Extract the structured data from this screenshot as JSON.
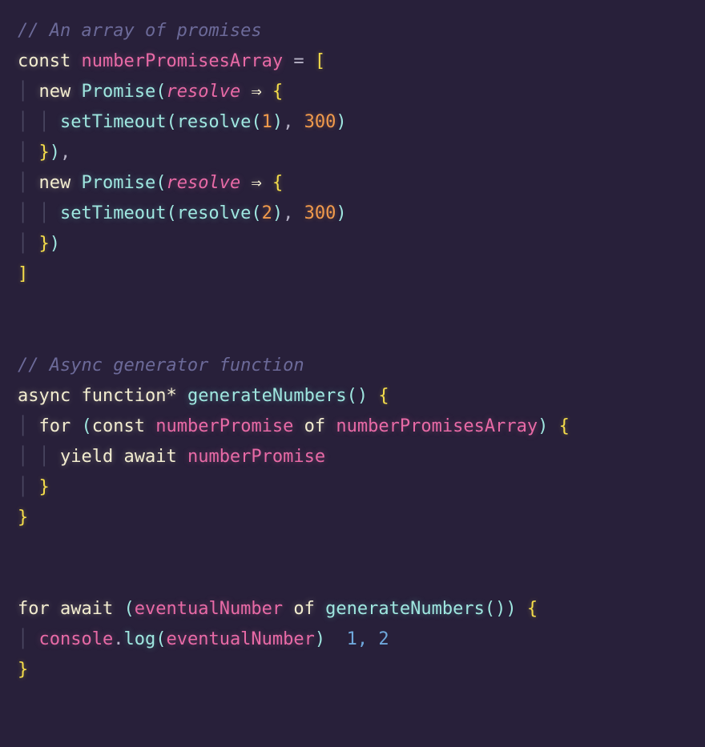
{
  "code": {
    "lines": [
      [
        {
          "cls": "tok-comment",
          "text": "// An array of promises"
        }
      ],
      [
        {
          "cls": "tok-keyword",
          "text": "const"
        },
        {
          "cls": "",
          "text": " "
        },
        {
          "cls": "tok-ident",
          "text": "numberPromisesArray"
        },
        {
          "cls": "",
          "text": " "
        },
        {
          "cls": "tok-op",
          "text": "="
        },
        {
          "cls": "",
          "text": " "
        },
        {
          "cls": "tok-bracket",
          "text": "["
        }
      ],
      [
        {
          "cls": "tok-guide",
          "text": "│ "
        },
        {
          "cls": "tok-keyword",
          "text": "new"
        },
        {
          "cls": "",
          "text": " "
        },
        {
          "cls": "tok-fn",
          "text": "Promise"
        },
        {
          "cls": "tok-paren",
          "text": "("
        },
        {
          "cls": "tok-arg",
          "text": "resolve"
        },
        {
          "cls": "",
          "text": " "
        },
        {
          "cls": "tok-arrow",
          "text": "⇒"
        },
        {
          "cls": "",
          "text": " "
        },
        {
          "cls": "tok-brace",
          "text": "{"
        }
      ],
      [
        {
          "cls": "tok-guide",
          "text": "│ │ "
        },
        {
          "cls": "tok-fn",
          "text": "setTimeout"
        },
        {
          "cls": "tok-paren",
          "text": "("
        },
        {
          "cls": "tok-fn",
          "text": "resolve"
        },
        {
          "cls": "tok-paren",
          "text": "("
        },
        {
          "cls": "tok-num",
          "text": "1"
        },
        {
          "cls": "tok-paren",
          "text": ")"
        },
        {
          "cls": "tok-punct",
          "text": ", "
        },
        {
          "cls": "tok-num",
          "text": "300"
        },
        {
          "cls": "tok-paren",
          "text": ")"
        }
      ],
      [
        {
          "cls": "tok-guide",
          "text": "│ "
        },
        {
          "cls": "tok-brace",
          "text": "}"
        },
        {
          "cls": "tok-paren",
          "text": ")"
        },
        {
          "cls": "tok-punct",
          "text": ","
        }
      ],
      [
        {
          "cls": "tok-guide",
          "text": "│ "
        },
        {
          "cls": "tok-keyword",
          "text": "new"
        },
        {
          "cls": "",
          "text": " "
        },
        {
          "cls": "tok-fn",
          "text": "Promise"
        },
        {
          "cls": "tok-paren",
          "text": "("
        },
        {
          "cls": "tok-arg",
          "text": "resolve"
        },
        {
          "cls": "",
          "text": " "
        },
        {
          "cls": "tok-arrow",
          "text": "⇒"
        },
        {
          "cls": "",
          "text": " "
        },
        {
          "cls": "tok-brace",
          "text": "{"
        }
      ],
      [
        {
          "cls": "tok-guide",
          "text": "│ │ "
        },
        {
          "cls": "tok-fn",
          "text": "setTimeout"
        },
        {
          "cls": "tok-paren",
          "text": "("
        },
        {
          "cls": "tok-fn",
          "text": "resolve"
        },
        {
          "cls": "tok-paren",
          "text": "("
        },
        {
          "cls": "tok-num",
          "text": "2"
        },
        {
          "cls": "tok-paren",
          "text": ")"
        },
        {
          "cls": "tok-punct",
          "text": ", "
        },
        {
          "cls": "tok-num",
          "text": "300"
        },
        {
          "cls": "tok-paren",
          "text": ")"
        }
      ],
      [
        {
          "cls": "tok-guide",
          "text": "│ "
        },
        {
          "cls": "tok-brace",
          "text": "}"
        },
        {
          "cls": "tok-paren",
          "text": ")"
        }
      ],
      [
        {
          "cls": "tok-bracket",
          "text": "]"
        }
      ],
      [],
      [],
      [
        {
          "cls": "tok-comment",
          "text": "// Async generator function"
        }
      ],
      [
        {
          "cls": "tok-keyword",
          "text": "async"
        },
        {
          "cls": "",
          "text": " "
        },
        {
          "cls": "tok-keyword",
          "text": "function*"
        },
        {
          "cls": "",
          "text": " "
        },
        {
          "cls": "tok-fn",
          "text": "generateNumbers"
        },
        {
          "cls": "tok-paren",
          "text": "()"
        },
        {
          "cls": "",
          "text": " "
        },
        {
          "cls": "tok-brace",
          "text": "{"
        }
      ],
      [
        {
          "cls": "tok-guide",
          "text": "│ "
        },
        {
          "cls": "tok-keyword",
          "text": "for"
        },
        {
          "cls": "",
          "text": " "
        },
        {
          "cls": "tok-paren",
          "text": "("
        },
        {
          "cls": "tok-keyword",
          "text": "const"
        },
        {
          "cls": "",
          "text": " "
        },
        {
          "cls": "tok-ident",
          "text": "numberPromise"
        },
        {
          "cls": "",
          "text": " "
        },
        {
          "cls": "tok-keyword",
          "text": "of"
        },
        {
          "cls": "",
          "text": " "
        },
        {
          "cls": "tok-ident",
          "text": "numberPromisesArray"
        },
        {
          "cls": "tok-paren",
          "text": ")"
        },
        {
          "cls": "",
          "text": " "
        },
        {
          "cls": "tok-brace",
          "text": "{"
        }
      ],
      [
        {
          "cls": "tok-guide",
          "text": "│ │ "
        },
        {
          "cls": "tok-keyword",
          "text": "yield"
        },
        {
          "cls": "",
          "text": " "
        },
        {
          "cls": "tok-keyword",
          "text": "await"
        },
        {
          "cls": "",
          "text": " "
        },
        {
          "cls": "tok-ident",
          "text": "numberPromise"
        }
      ],
      [
        {
          "cls": "tok-guide",
          "text": "│ "
        },
        {
          "cls": "tok-brace",
          "text": "}"
        }
      ],
      [
        {
          "cls": "tok-brace",
          "text": "}"
        }
      ],
      [],
      [],
      [
        {
          "cls": "tok-keyword",
          "text": "for"
        },
        {
          "cls": "",
          "text": " "
        },
        {
          "cls": "tok-keyword",
          "text": "await"
        },
        {
          "cls": "",
          "text": " "
        },
        {
          "cls": "tok-paren",
          "text": "("
        },
        {
          "cls": "tok-ident",
          "text": "eventualNumber"
        },
        {
          "cls": "",
          "text": " "
        },
        {
          "cls": "tok-keyword",
          "text": "of"
        },
        {
          "cls": "",
          "text": " "
        },
        {
          "cls": "tok-fn",
          "text": "generateNumbers"
        },
        {
          "cls": "tok-paren",
          "text": "()"
        },
        {
          "cls": "tok-paren",
          "text": ")"
        },
        {
          "cls": "",
          "text": " "
        },
        {
          "cls": "tok-brace",
          "text": "{"
        }
      ],
      [
        {
          "cls": "tok-guide",
          "text": "│ "
        },
        {
          "cls": "tok-ident",
          "text": "console"
        },
        {
          "cls": "tok-punct",
          "text": "."
        },
        {
          "cls": "tok-fn",
          "text": "log"
        },
        {
          "cls": "tok-paren",
          "text": "("
        },
        {
          "cls": "tok-ident",
          "text": "eventualNumber"
        },
        {
          "cls": "tok-paren",
          "text": ")"
        },
        {
          "cls": "",
          "text": "  "
        },
        {
          "cls": "tok-outnum",
          "text": "1, 2"
        }
      ],
      [
        {
          "cls": "tok-brace",
          "text": "}"
        }
      ]
    ]
  }
}
